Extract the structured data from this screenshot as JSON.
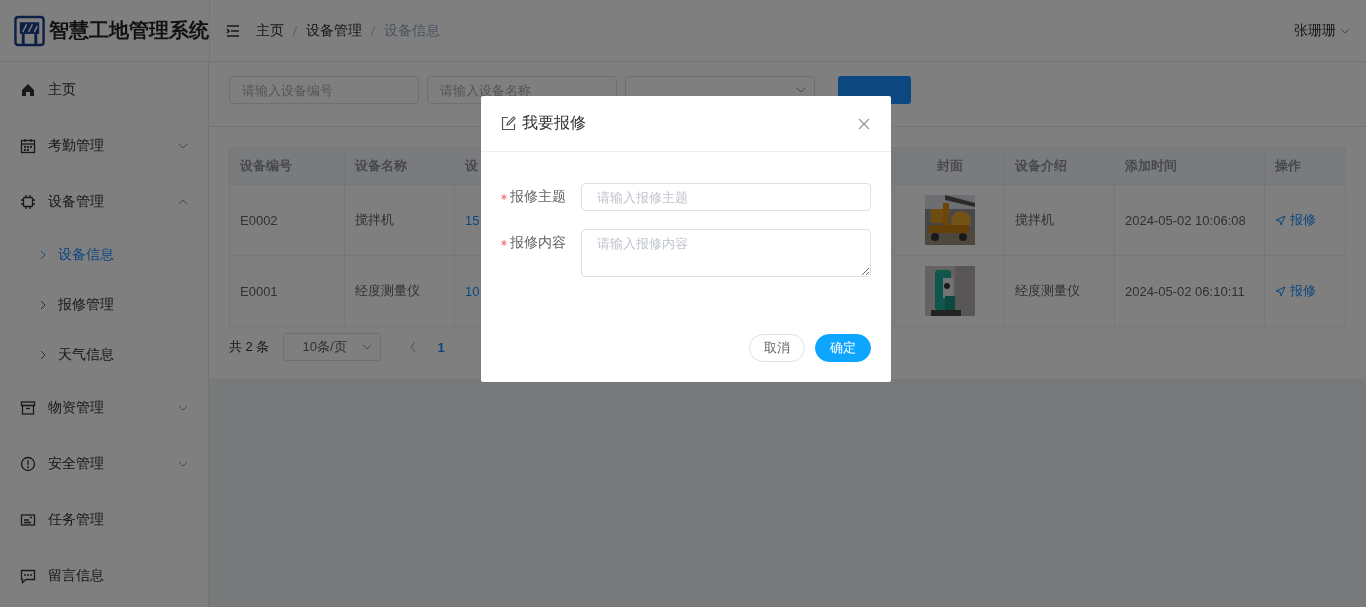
{
  "app": {
    "title": "智慧工地管理系统"
  },
  "header": {
    "breadcrumbs": [
      {
        "label": "主页",
        "selected": false
      },
      {
        "label": "设备管理",
        "selected": false
      },
      {
        "label": "设备信息",
        "selected": true
      }
    ],
    "user": "张珊珊"
  },
  "sidebar": {
    "items": [
      {
        "label": "主页"
      },
      {
        "label": "考勤管理",
        "expanded": false
      },
      {
        "label": "设备管理",
        "expanded": true,
        "children": [
          {
            "label": "设备信息",
            "selected": true
          },
          {
            "label": "报修管理",
            "selected": false
          },
          {
            "label": "天气信息",
            "selected": false
          }
        ]
      },
      {
        "label": "物资管理",
        "expanded": false
      },
      {
        "label": "安全管理",
        "expanded": false
      },
      {
        "label": "任务管理"
      },
      {
        "label": "留言信息"
      }
    ]
  },
  "filters": [
    {
      "kind": "input",
      "placeholder": "请输入设备编号"
    },
    {
      "kind": "input",
      "placeholder": "请输入设备名称"
    },
    {
      "kind": "select"
    }
  ],
  "search_button": {
    "kind": "primary"
  },
  "table": {
    "columns": [
      "设备编号",
      "设备名称",
      "设",
      "封面",
      "设备介绍",
      "添加时间",
      "操作"
    ],
    "rows": [
      {
        "code": "E0002",
        "name": "搅拌机",
        "column_3": "15",
        "intro": "搅拌机",
        "added": "2024-05-02 10:06:08",
        "action": "报修"
      },
      {
        "code": "E0001",
        "name": "经度测量仪",
        "column_3": "10",
        "intro": "经度测量仪",
        "added": "2024-05-02 06:10:11",
        "action": "报修"
      }
    ]
  },
  "pagination": {
    "total": "共 2 条",
    "page_size": "10条/页",
    "pages": [
      {
        "label": "1",
        "selected": true
      }
    ]
  },
  "modal": {
    "title": "我要报修",
    "fields": [
      {
        "kind": "input",
        "label": "报修主题",
        "required": true,
        "placeholder": "请输入报修主题"
      },
      {
        "kind": "textarea",
        "label": "报修内容",
        "required": true,
        "placeholder": "请输入报修内容"
      }
    ],
    "buttons": [
      {
        "kind": "default",
        "label": "取消"
      },
      {
        "kind": "primary",
        "label": "确定"
      }
    ]
  }
}
